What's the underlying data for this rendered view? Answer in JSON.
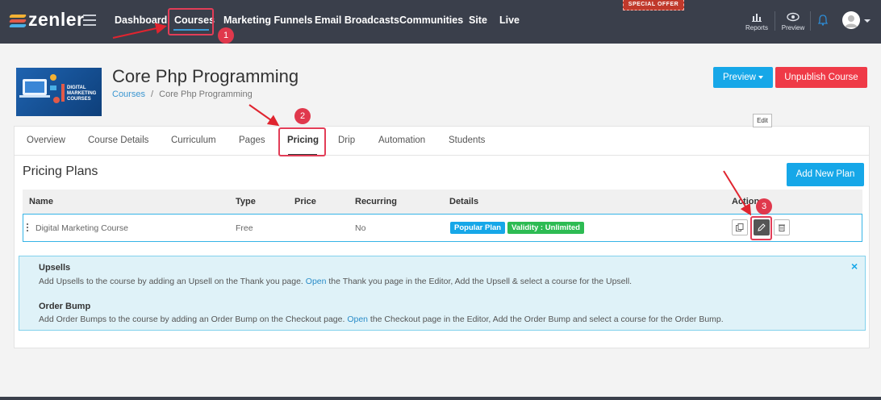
{
  "nav": {
    "logo": "zenler",
    "items": [
      "Dashboard",
      "Courses",
      "Marketing Funnels",
      "Email Broadcasts",
      "Communities",
      "Site",
      "Live"
    ],
    "special_offer": "SPECIAL OFFER",
    "reports": "Reports",
    "preview": "Preview"
  },
  "course": {
    "thumbnail_text": "DIGITAL MARKETING COURSES",
    "title": "Core Php Programming",
    "breadcrumb_root": "Courses",
    "breadcrumb_sep": "/",
    "breadcrumb_current": "Core Php Programming",
    "preview_button": "Preview",
    "unpublish_button": "Unpublish Course"
  },
  "tabs": [
    "Overview",
    "Course Details",
    "Curriculum",
    "Pages",
    "Pricing",
    "Drip",
    "Automation",
    "Students"
  ],
  "pricing": {
    "title": "Pricing Plans",
    "add_button": "Add New Plan",
    "columns": [
      "Name",
      "Type",
      "Price",
      "Recurring",
      "Details",
      "Actions"
    ],
    "rows": [
      {
        "name": "Digital Marketing Course",
        "type": "Free",
        "price": "",
        "recurring": "No",
        "badges": [
          "Popular Plan",
          "Validity : Unlimited"
        ]
      }
    ],
    "edit_tooltip": "Edit"
  },
  "info": {
    "upsells_title": "Upsells",
    "upsells_text_1": "Add Upsells to the course by adding an Upsell on the Thank you page. ",
    "upsells_link": "Open",
    "upsells_text_2": " the Thank you page in the Editor, Add the Upsell & select a course for the Upsell.",
    "bump_title": "Order Bump",
    "bump_text_1": "Add Order Bumps to the course by adding an Order Bump on the Checkout page. ",
    "bump_link": "Open",
    "bump_text_2": " the Checkout page in the Editor, Add the Order Bump and select a course for the Order Bump.",
    "close": "×"
  },
  "annotations": [
    "1",
    "2",
    "3"
  ],
  "colors": {
    "nav_bg": "#3a3f4b",
    "primary": "#16a7e8",
    "danger": "#ef3a47",
    "success": "#2dbb53",
    "annotation": "#e0384c"
  }
}
